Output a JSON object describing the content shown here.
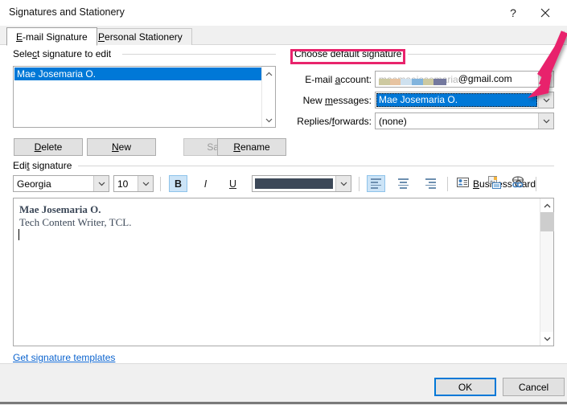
{
  "window": {
    "title": "Signatures and Stationery",
    "help_icon": "help-question-icon",
    "close_icon": "close-icon"
  },
  "tabs": [
    {
      "label": "E-mail Signature",
      "active": true
    },
    {
      "label": "Personal Stationery",
      "active": false
    }
  ],
  "select_signature": {
    "group_label": "Select signature to edit",
    "items": [
      "Mae Josemaria O."
    ],
    "selected": "Mae Josemaria O.",
    "scroll_up_icon": "chevron-up-icon",
    "scroll_down_icon": "chevron-down-icon"
  },
  "signature_buttons": [
    {
      "label": "Delete",
      "enabled": true
    },
    {
      "label": "New",
      "enabled": true
    },
    {
      "label": "Save",
      "enabled": false
    },
    {
      "label": "Rename",
      "enabled": true
    }
  ],
  "choose_default": {
    "group_label": "Choose default signature",
    "fields": [
      {
        "label": "E-mail account:",
        "value": "@gmail.com",
        "redacted": true,
        "redacted_placeholder": "maemaejosemaria",
        "dropdown_icon": "chevron-down-icon"
      },
      {
        "label": "New messages:",
        "value": "Mae Josemaria O.",
        "selected": true,
        "dropdown_icon": "chevron-down-icon"
      },
      {
        "label": "Replies/forwards:",
        "value": "(none)",
        "dropdown_icon": "chevron-down-icon"
      }
    ]
  },
  "edit_signature": {
    "group_label": "Edit signature",
    "toolbar": {
      "font_family": "Georgia",
      "font_size": "10",
      "bold_label": "B",
      "bold_active": true,
      "italic_label": "I",
      "underline_label": "U",
      "font_color": "#3c4858",
      "align_left_active": true,
      "business_card_label": "Business Card",
      "business_card_icon": "business-card-icon",
      "insert_picture_icon": "insert-picture-icon",
      "insert_hyperlink_icon": "hyperlink-icon",
      "font_dropdown_icon": "chevron-down-icon",
      "size_dropdown_icon": "chevron-down-icon",
      "color_dropdown_icon": "chevron-down-icon"
    },
    "content": {
      "line1": "Mae Josemaria O.",
      "line2": "Tech Content Writer, TCL."
    },
    "scroll_up_icon": "chevron-up-icon",
    "scroll_down_icon": "chevron-down-icon"
  },
  "templates_link": "Get signature templates",
  "footer": {
    "ok_label": "OK",
    "cancel_label": "Cancel"
  },
  "annotations": {
    "highlight_color": "#e8246c",
    "box_target": "Choose default signature",
    "arrow_target": "New messages dropdown"
  },
  "colors": {
    "accent": "#0078d7",
    "annotation": "#e8246c",
    "signature_text": "#3c4858",
    "link": "#0b63ce"
  }
}
